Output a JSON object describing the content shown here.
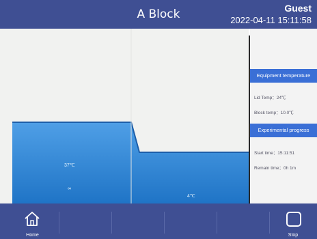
{
  "header": {
    "title": "A Block",
    "user": "Guest",
    "datetime": "2022-04-11 15:11:58"
  },
  "chart_data": {
    "type": "area",
    "segments": [
      {
        "temperature_label": "37℃",
        "hold_label": "∞"
      },
      {
        "temperature_label": "4℃"
      }
    ],
    "colors": {
      "fill_top": "#4f9fe6",
      "fill_bottom": "#1f74c6",
      "stroke": "#1c5ea9"
    }
  },
  "panel": {
    "equipment_header": "Equipment temperature",
    "lid_temp": "Lid Temp：24℃",
    "block_temp": "Block temp：10.0℃",
    "progress_header": "Experimental progress",
    "start_time": "Start time：15:11:51",
    "remain_time": "Remain time：0h 1m"
  },
  "footer": {
    "home_label": "Home",
    "stop_label": "Stop",
    "home_icon": "home-icon",
    "stop_icon": "stop-icon"
  }
}
